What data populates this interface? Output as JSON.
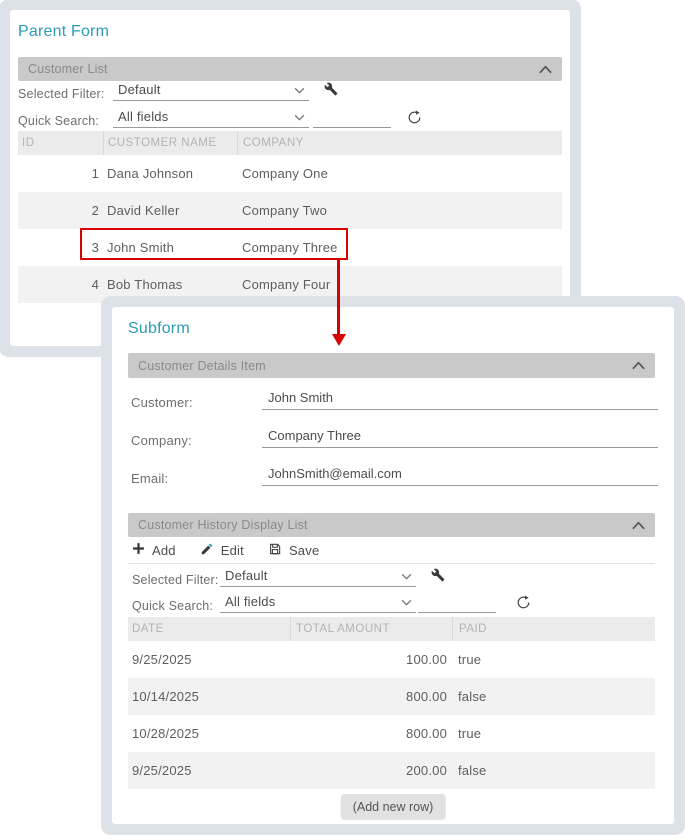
{
  "colors": {
    "accent": "#2b9bb8",
    "highlight": "#d90000",
    "panel_header_bg": "#c9c9c9",
    "grid_header_bg": "#ebebeb",
    "alt_row_bg": "#f2f2f2"
  },
  "parent_form": {
    "title": "Parent Form",
    "panel": {
      "title": "Customer List"
    },
    "filter": {
      "selected_filter_label": "Selected Filter:",
      "selected_filter_value": "Default",
      "quick_search_label": "Quick Search:",
      "quick_search_value": "All fields",
      "search_value": ""
    },
    "table": {
      "columns": [
        "ID",
        "CUSTOMER NAME",
        "COMPANY"
      ],
      "rows": [
        {
          "id": "1",
          "name": "Dana Johnson",
          "company": "Company One"
        },
        {
          "id": "2",
          "name": "David Keller",
          "company": "Company Two"
        },
        {
          "id": "3",
          "name": "John Smith",
          "company": "Company Three"
        },
        {
          "id": "4",
          "name": "Bob Thomas",
          "company": "Company Four"
        }
      ],
      "selected_row_index": 2
    }
  },
  "subform": {
    "title": "Subform",
    "details_panel": {
      "title": "Customer Details Item",
      "fields": [
        {
          "label": "Customer:",
          "value": "John Smith"
        },
        {
          "label": "Company:",
          "value": "Company Three"
        },
        {
          "label": "Email:",
          "value": "JohnSmith@email.com"
        }
      ]
    },
    "history_panel": {
      "title": "Customer History Display List",
      "toolbar": {
        "add": "Add",
        "edit": "Edit",
        "save": "Save"
      },
      "filter": {
        "selected_filter_label": "Selected Filter:",
        "selected_filter_value": "Default",
        "quick_search_label": "Quick Search:",
        "quick_search_value": "All fields",
        "search_value": ""
      },
      "table": {
        "columns": [
          "DATE",
          "TOTAL AMOUNT",
          "PAID"
        ],
        "rows": [
          {
            "date": "9/25/2025",
            "total": "100.00",
            "paid": "true"
          },
          {
            "date": "10/14/2025",
            "total": "800.00",
            "paid": "false"
          },
          {
            "date": "10/28/2025",
            "total": "800.00",
            "paid": "true"
          },
          {
            "date": "9/25/2025",
            "total": "200.00",
            "paid": "false"
          }
        ]
      },
      "add_new_row_label": "(Add new row)"
    }
  }
}
